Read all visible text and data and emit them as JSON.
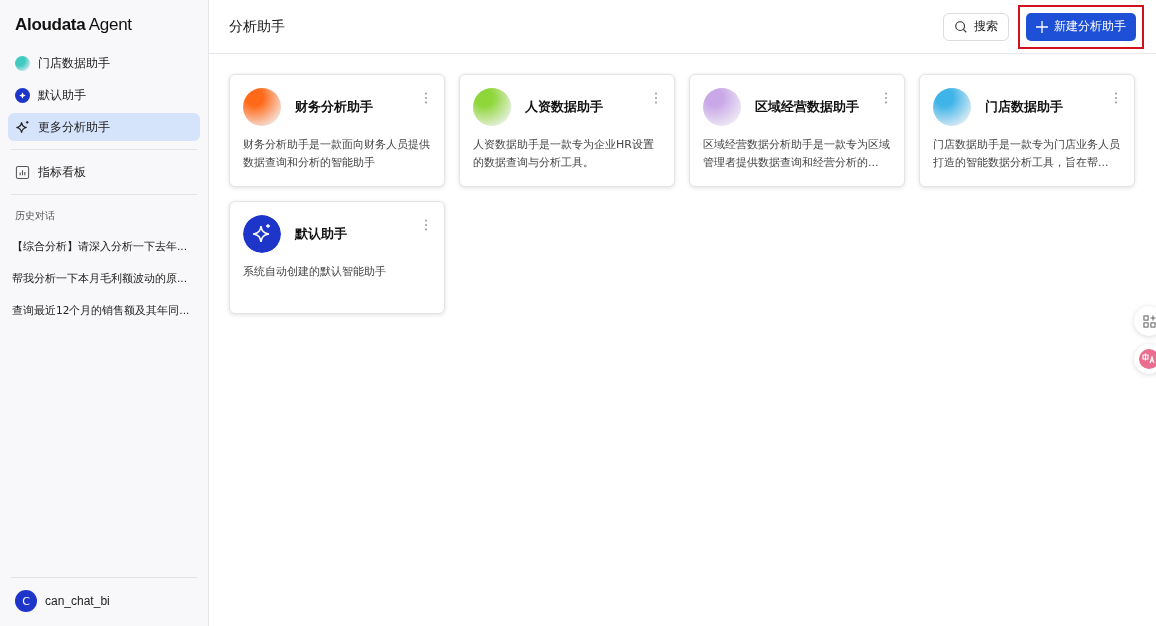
{
  "brand": {
    "name": "Aloudata",
    "suffix": "Agent"
  },
  "sidebar": {
    "items": [
      {
        "label": "门店数据助手",
        "kind": "gradient",
        "color": "#3fc9c0",
        "selected": false
      },
      {
        "label": "默认助手",
        "kind": "sparkle-avatar",
        "selected": false
      },
      {
        "label": "更多分析助手",
        "kind": "sparkle",
        "selected": true
      }
    ],
    "dashboard": {
      "label": "指标看板",
      "selected": false
    },
    "history_title": "历史对话",
    "history": [
      {
        "label": "【综合分析】请深入分析一下去年..."
      },
      {
        "label": "帮我分析一下本月毛利额波动的原..."
      },
      {
        "label": "查询最近12个月的销售额及其年同..."
      }
    ],
    "user": {
      "initial": "C",
      "name": "can_chat_bi"
    }
  },
  "header": {
    "title": "分析助手",
    "search": "搜索",
    "new_button": {
      "label": "新建分析助手",
      "highlighted": true
    }
  },
  "cards": [
    {
      "title": "财务分析助手",
      "description": "财务分析助手是一款面向财务人员提供数据查询和分析的智能助手",
      "kind": "gradient",
      "color": "#ff6a1a"
    },
    {
      "title": "人资数据助手",
      "description": "人资数据助手是一款专为企业HR设置的数据查询与分析工具。",
      "kind": "gradient",
      "color": "#8fd63a"
    },
    {
      "title": "区域经营数据助手",
      "description": "区域经营数据分析助手是一款专为区域管理者提供数据查询和经营分析的...",
      "kind": "gradient",
      "color": "#c9a8e8"
    },
    {
      "title": "门店数据助手",
      "description": "门店数据助手是一款专为门店业务人员打造的智能数据分析工具，旨在帮...",
      "kind": "gradient",
      "color": "#3fb4e8"
    },
    {
      "title": "默认助手",
      "description": "系统自动创建的默认智能助手",
      "kind": "sparkle-avatar"
    }
  ]
}
